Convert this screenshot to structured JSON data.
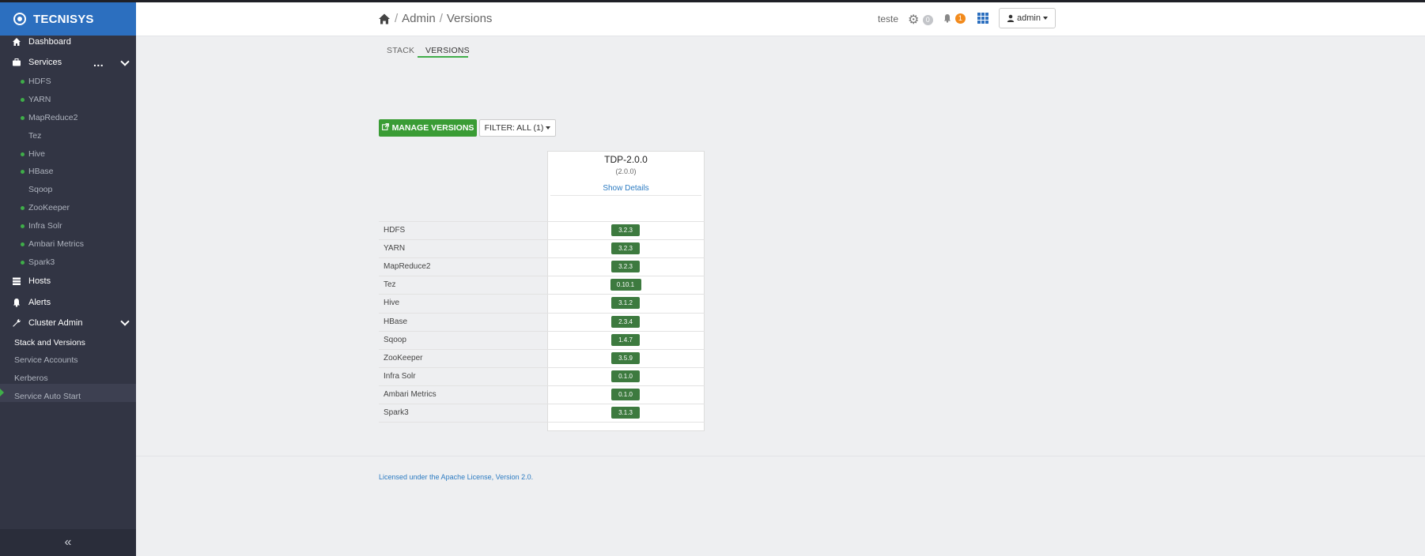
{
  "brand": "TECNISYS",
  "sidebar": {
    "dashboard": "Dashboard",
    "services": "Services",
    "services_more": "...",
    "service_items": [
      {
        "label": "HDFS",
        "status": "green"
      },
      {
        "label": "YARN",
        "status": "green"
      },
      {
        "label": "MapReduce2",
        "status": "green"
      },
      {
        "label": "Tez",
        "status": "none"
      },
      {
        "label": "Hive",
        "status": "green"
      },
      {
        "label": "HBase",
        "status": "green"
      },
      {
        "label": "Sqoop",
        "status": "none"
      },
      {
        "label": "ZooKeeper",
        "status": "green"
      },
      {
        "label": "Infra Solr",
        "status": "green"
      },
      {
        "label": "Ambari Metrics",
        "status": "green"
      },
      {
        "label": "Spark3",
        "status": "green"
      }
    ],
    "hosts": "Hosts",
    "alerts": "Alerts",
    "cluster_admin": "Cluster Admin",
    "cluster_admin_items": [
      {
        "label": "Stack and Versions"
      },
      {
        "label": "Service Accounts"
      },
      {
        "label": "Kerberos"
      },
      {
        "label": "Service Auto Start"
      }
    ],
    "collapse_icon": "«"
  },
  "header": {
    "crumb_admin": "Admin",
    "crumb_current": "Versions",
    "sep": "/",
    "user": "teste",
    "ops_count": "0",
    "alerts_count": "1",
    "admin_label": "admin"
  },
  "tabs": [
    {
      "label": "STACK"
    },
    {
      "label": "VERSIONS"
    }
  ],
  "buttons": {
    "manage": "MANAGE VERSIONS",
    "filter": "FILTER: ALL (1)"
  },
  "stack": {
    "name": "TDP-2.0.0",
    "version": "(2.0.0)",
    "show_details": "Show Details"
  },
  "services": [
    {
      "name": "HDFS",
      "version": "3.2.3"
    },
    {
      "name": "YARN",
      "version": "3.2.3"
    },
    {
      "name": "MapReduce2",
      "version": "3.2.3"
    },
    {
      "name": "Tez",
      "version": "0.10.1"
    },
    {
      "name": "Hive",
      "version": "3.1.2"
    },
    {
      "name": "HBase",
      "version": "2.3.4"
    },
    {
      "name": "Sqoop",
      "version": "1.4.7"
    },
    {
      "name": "ZooKeeper",
      "version": "3.5.9"
    },
    {
      "name": "Infra Solr",
      "version": "0.1.0"
    },
    {
      "name": "Ambari Metrics",
      "version": "0.1.0"
    },
    {
      "name": "Spark3",
      "version": "3.1.3"
    }
  ],
  "footer": {
    "license": "Licensed under the Apache License, Version 2.0."
  }
}
